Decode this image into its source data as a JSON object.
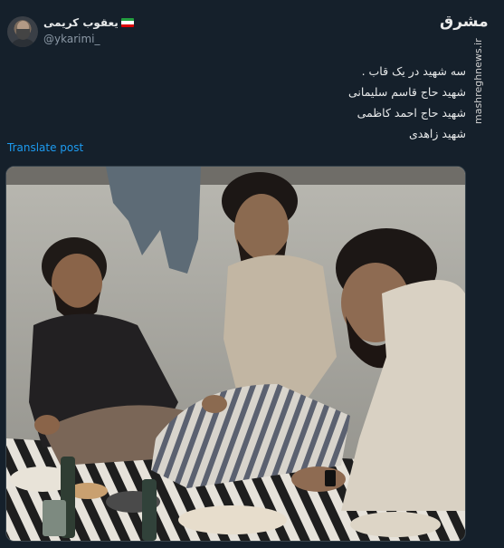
{
  "author": {
    "name": "یعقوب کریمی",
    "handle": "@ykarimi_"
  },
  "site": {
    "logo": "مشرق",
    "watermark": "mashreghnews.ir"
  },
  "post": {
    "lines": [
      "سه شهید در یک قاب .",
      "شهید حاج قاسم سلیمانی",
      "شهید حاج احمد کاظمی",
      "شهید  زاهدی"
    ],
    "translate_label": "Translate post"
  },
  "colors": {
    "background": "#15202b",
    "link": "#1d9bf0",
    "text": "#e7e9ea",
    "muted": "#8b98a5"
  }
}
